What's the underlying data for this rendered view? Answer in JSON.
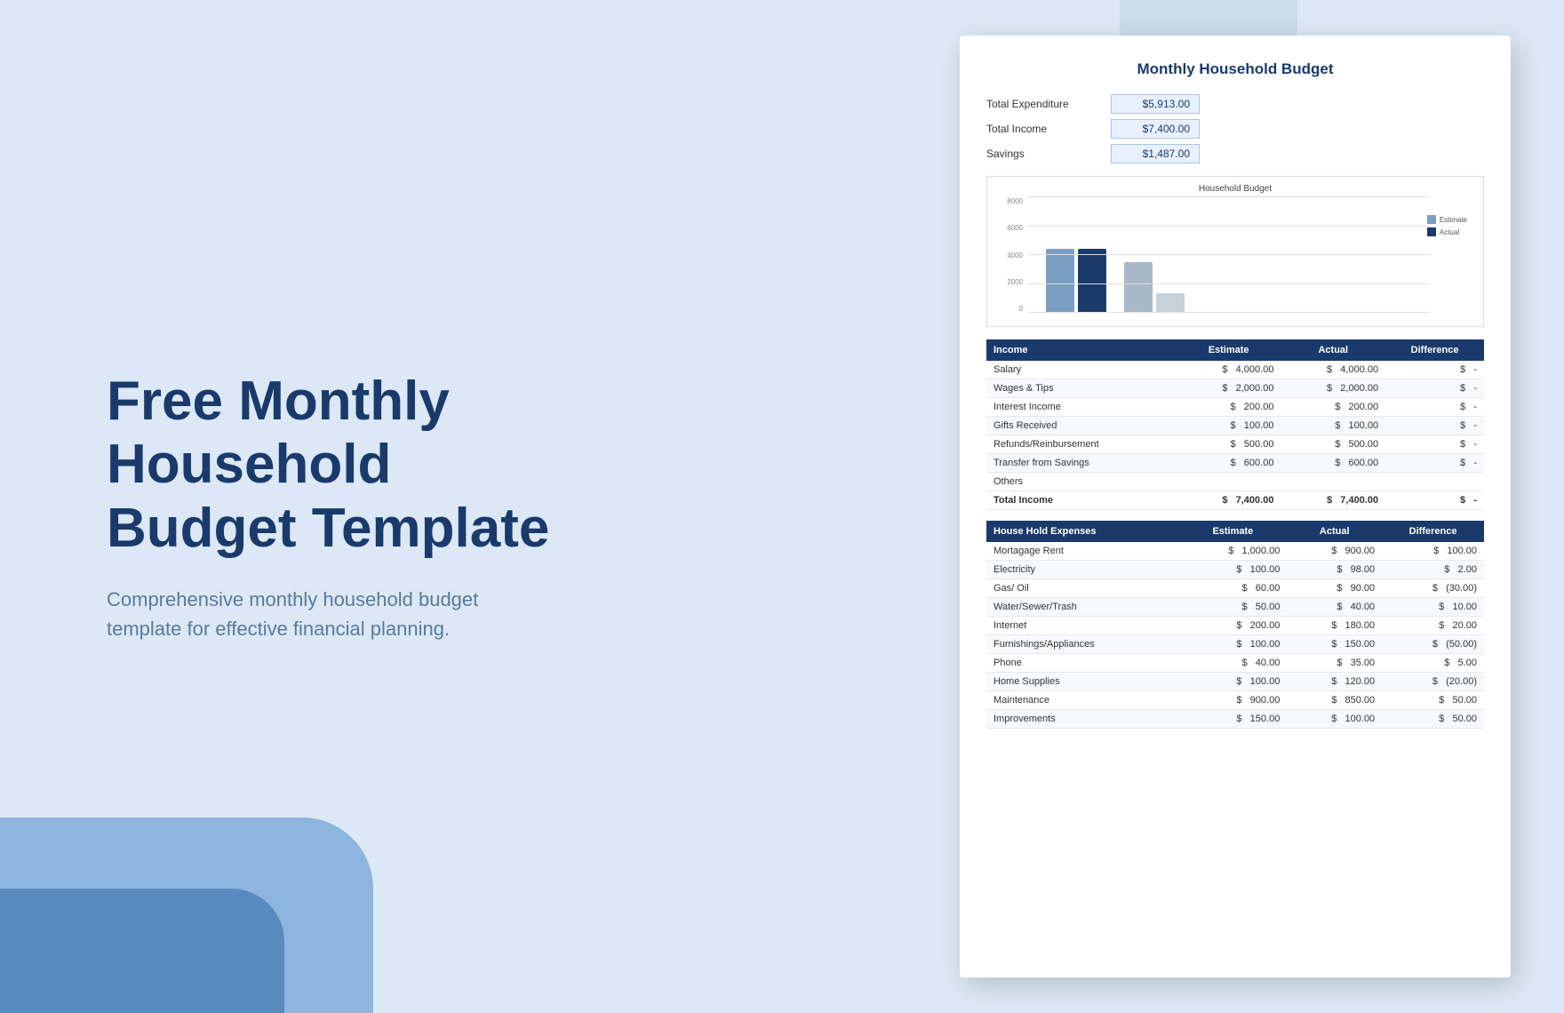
{
  "background": {
    "color": "#dce8f5"
  },
  "left": {
    "title_line1": "Free Monthly Household",
    "title_line2": "Budget Template",
    "subtitle": "Comprehensive monthly household budget template for effective financial planning."
  },
  "document": {
    "title": "Monthly Household Budget",
    "summary": {
      "total_expenditure_label": "Total Expenditure",
      "total_expenditure_value": "$5,913.00",
      "total_income_label": "Total Income",
      "total_income_value": "$7,400.00",
      "savings_label": "Savings",
      "savings_value": "$1,487.00"
    },
    "chart": {
      "title": "Household Budget",
      "y_labels": [
        "0",
        "2000",
        "4000",
        "6000",
        "8000"
      ],
      "legend": [
        {
          "label": "Estimate",
          "color": "#7a9fc2"
        },
        {
          "label": "Actual",
          "color": "#1a3a6b"
        }
      ]
    },
    "income_table": {
      "header": {
        "category": "Income",
        "estimate": "Estimate",
        "actual": "Actual",
        "difference": "Difference"
      },
      "rows": [
        {
          "name": "Salary",
          "est_sym": "$",
          "est": "4,000.00",
          "act_sym": "$",
          "act": "4,000.00",
          "diff_sym": "$",
          "diff": "-"
        },
        {
          "name": "Wages & Tips",
          "est_sym": "$",
          "est": "2,000.00",
          "act_sym": "$",
          "act": "2,000.00",
          "diff_sym": "$",
          "diff": "-"
        },
        {
          "name": "Interest Income",
          "est_sym": "$",
          "est": "200.00",
          "act_sym": "$",
          "act": "200.00",
          "diff_sym": "$",
          "diff": "-"
        },
        {
          "name": "Gifts Received",
          "est_sym": "$",
          "est": "100.00",
          "act_sym": "$",
          "act": "100.00",
          "diff_sym": "$",
          "diff": "-"
        },
        {
          "name": "Refunds/Reinbursement",
          "est_sym": "$",
          "est": "500.00",
          "act_sym": "$",
          "act": "500.00",
          "diff_sym": "$",
          "diff": "-"
        },
        {
          "name": "Transfer from Savings",
          "est_sym": "$",
          "est": "600.00",
          "act_sym": "$",
          "act": "600.00",
          "diff_sym": "$",
          "diff": "-"
        },
        {
          "name": "Others",
          "est_sym": "",
          "est": "",
          "act_sym": "",
          "act": "",
          "diff_sym": "",
          "diff": ""
        }
      ],
      "total": {
        "label": "Total Income",
        "est_sym": "$",
        "est": "7,400.00",
        "act_sym": "$",
        "act": "7,400.00",
        "diff_sym": "$",
        "diff": "-"
      }
    },
    "expenses_table": {
      "header": {
        "category": "House Hold Expenses",
        "estimate": "Estimate",
        "actual": "Actual",
        "difference": "Difference"
      },
      "rows": [
        {
          "name": "Mortagage Rent",
          "est_sym": "$",
          "est": "1,000.00",
          "act_sym": "$",
          "act": "900.00",
          "diff_sym": "$",
          "diff": "100.00"
        },
        {
          "name": "Electricity",
          "est_sym": "$",
          "est": "100.00",
          "act_sym": "$",
          "act": "98.00",
          "diff_sym": "$",
          "diff": "2.00"
        },
        {
          "name": "Gas/ Oil",
          "est_sym": "$",
          "est": "60.00",
          "act_sym": "$",
          "act": "90.00",
          "diff_sym": "$",
          "diff": "(30.00)"
        },
        {
          "name": "Water/Sewer/Trash",
          "est_sym": "$",
          "est": "50.00",
          "act_sym": "$",
          "act": "40.00",
          "diff_sym": "$",
          "diff": "10.00"
        },
        {
          "name": "Internet",
          "est_sym": "$",
          "est": "200.00",
          "act_sym": "$",
          "act": "180.00",
          "diff_sym": "$",
          "diff": "20.00"
        },
        {
          "name": "Furnishings/Appliances",
          "est_sym": "$",
          "est": "100.00",
          "act_sym": "$",
          "act": "150.00",
          "diff_sym": "$",
          "diff": "(50.00)"
        },
        {
          "name": "Phone",
          "est_sym": "$",
          "est": "40.00",
          "act_sym": "$",
          "act": "35.00",
          "diff_sym": "$",
          "diff": "5.00"
        },
        {
          "name": "Home Supplies",
          "est_sym": "$",
          "est": "100.00",
          "act_sym": "$",
          "act": "120.00",
          "diff_sym": "$",
          "diff": "(20.00)"
        },
        {
          "name": "Maintenance",
          "est_sym": "$",
          "est": "900.00",
          "act_sym": "$",
          "act": "850.00",
          "diff_sym": "$",
          "diff": "50.00"
        },
        {
          "name": "Improvements",
          "est_sym": "$",
          "est": "150.00",
          "act_sym": "$",
          "act": "100.00",
          "diff_sym": "$",
          "diff": "50.00"
        }
      ]
    }
  }
}
